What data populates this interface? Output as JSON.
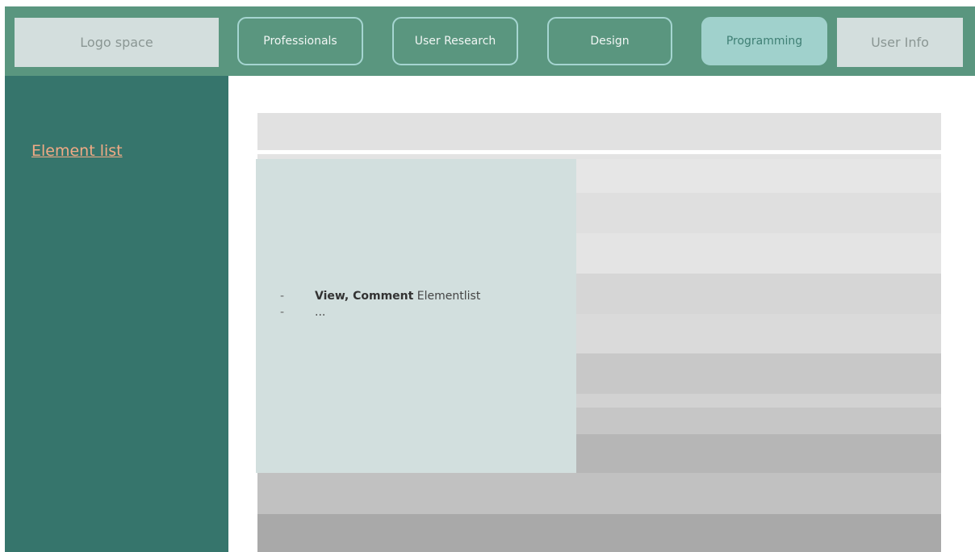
{
  "header": {
    "logo_label": "Logo space",
    "nav": [
      {
        "label": "Professionals",
        "active": false
      },
      {
        "label": "User Research",
        "active": false
      },
      {
        "label": "Design",
        "active": false
      },
      {
        "label": "Programming",
        "active": true
      }
    ],
    "user_info_label": "User Info"
  },
  "sidebar": {
    "link_label": "Element list"
  },
  "content": {
    "items": [
      {
        "bullet": "-",
        "strong": "View, Comment",
        "rest": " Elementlist"
      },
      {
        "bullet": "-",
        "strong": "",
        "rest": "..."
      }
    ]
  },
  "colors": {
    "topbar": "#5a967f",
    "sidebar": "#36756c",
    "link": "#f1aa85",
    "active_tab": "#a0d1cc",
    "tab_border": "#a5d5d1",
    "card": "#d2dfde"
  }
}
